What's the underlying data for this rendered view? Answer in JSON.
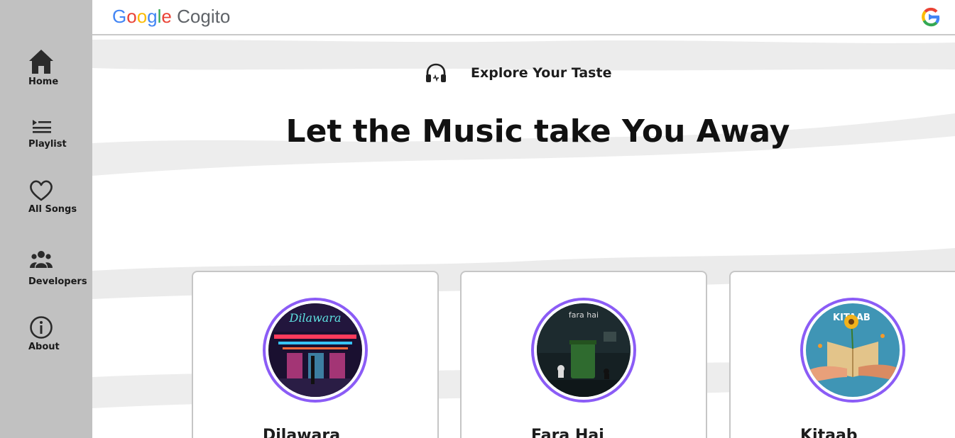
{
  "app": {
    "logo_google": "Google",
    "logo_product": "Cogito"
  },
  "sidebar": {
    "items": [
      {
        "label": "Home",
        "icon": "home-icon"
      },
      {
        "label": "Playlist",
        "icon": "playlist-icon"
      },
      {
        "label": "All Songs",
        "icon": "heart-icon"
      },
      {
        "label": "Developers",
        "icon": "users-icon"
      },
      {
        "label": "About",
        "icon": "info-icon"
      }
    ]
  },
  "hero": {
    "tagline": "Explore Your Taste",
    "headline": "Let the Music take You Away"
  },
  "songs": [
    {
      "title": "Dilawara",
      "art_text": "Dilawara"
    },
    {
      "title": "Fara Hai",
      "art_text": "fara hai"
    },
    {
      "title": "Kitaab",
      "art_text": "KITAAB"
    }
  ],
  "colors": {
    "sidebar_bg": "#c1c1c1",
    "accent_ring": "#8b5cf6"
  }
}
